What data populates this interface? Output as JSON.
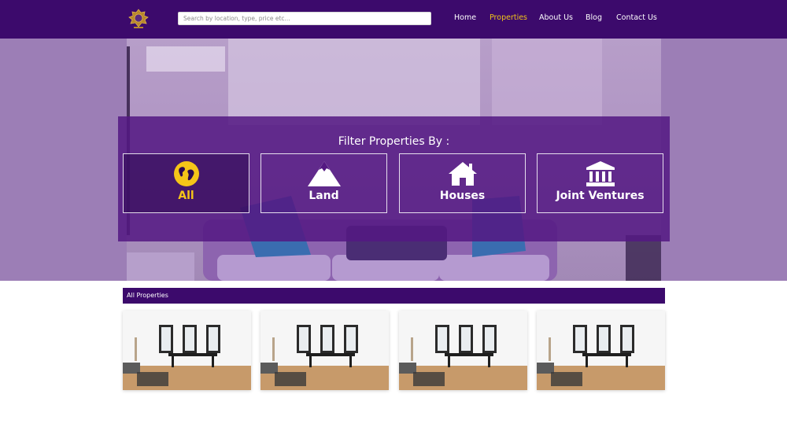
{
  "header": {
    "logo": "crest-logo",
    "search": {
      "placeholder": "Search by location, type, price etc...",
      "value": ""
    },
    "nav": [
      {
        "label": "Home",
        "active": false
      },
      {
        "label": "Properties",
        "active": true
      },
      {
        "label": "About Us",
        "active": false
      },
      {
        "label": "Blog",
        "active": false
      },
      {
        "label": "Contact Us",
        "active": false
      }
    ]
  },
  "filter": {
    "title": "Filter Properties By :",
    "options": [
      {
        "label": "All",
        "icon": "globe-icon",
        "active": true
      },
      {
        "label": "Land",
        "icon": "mountain-icon",
        "active": false
      },
      {
        "label": "Houses",
        "icon": "house-icon",
        "active": false
      },
      {
        "label": "Joint Ventures",
        "icon": "institution-icon",
        "active": false
      }
    ]
  },
  "listing": {
    "heading": "All Properties",
    "card_count": 4
  },
  "colors": {
    "brand_purple": "#3c0a6c",
    "accent_gold": "#f0c419",
    "overlay_purple": "#541982"
  }
}
